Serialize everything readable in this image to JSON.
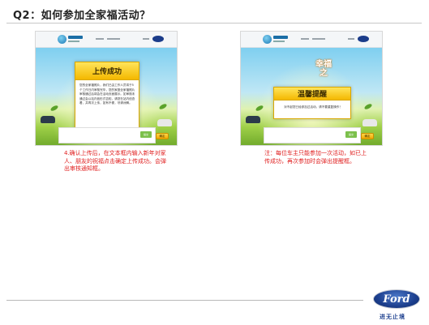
{
  "page": {
    "title": "Q2：如何参加全家福活动？"
  },
  "left_panel": {
    "dialog_title": "上传成功",
    "dialog_text": "您的全家福照片，我们已由工作人员将于5个工作日内审核完毕，您的家庭全家福照片审核通过后将会在活动页面展示。如审核未通过会以站内信形式告知，请您在站内信查看，并再次上传，如有不便，尽请谅解。",
    "confirm_label": "确定",
    "strip_button_label": "提交",
    "caption": "4.确认上传后，在文本框内输入新年对家人、朋友的祝福点击确定上传成功。会弹出审核通知框。"
  },
  "right_panel": {
    "banner_line1": "幸福",
    "banner_line2": "之",
    "dialog_title": "温馨提醒",
    "dialog_text": "对不起您已经参加过活动，请不要重复操作！",
    "confirm_label": "确定",
    "strip_button_label": "提交",
    "caption": "注：每位车主只能参加一次活动，如已上传成功，再次参加时会弹出提醒框。"
  },
  "footer": {
    "brand": "Ford",
    "tagline": "进无止境"
  },
  "colors": {
    "accent_red": "#e02020",
    "dialog_yellow": "#f4b800",
    "ford_blue": "#1c3f8e"
  }
}
